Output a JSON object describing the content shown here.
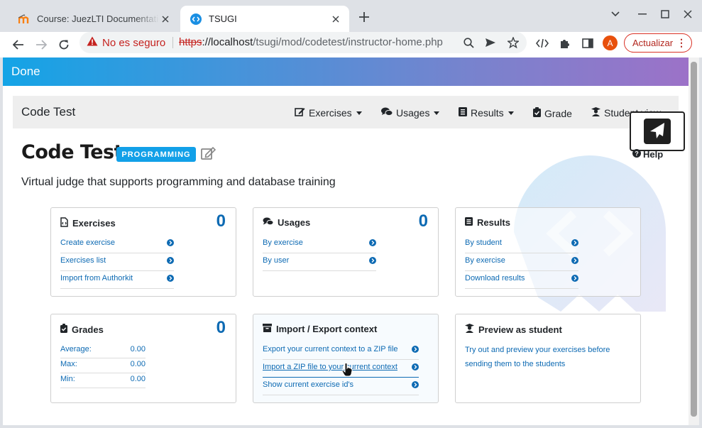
{
  "browser": {
    "tabs": [
      {
        "title": "Course: JuezLTI Documentation",
        "active": false
      },
      {
        "title": "TSUGI",
        "active": true
      }
    ],
    "security_label": "No es seguro",
    "url_scheme": "https",
    "url_host": "://localhost",
    "url_path": "/tsugi/mod/codetest/instructor-home.php",
    "avatar_letter": "A",
    "update_label": "Actualizar"
  },
  "page": {
    "done_label": "Done",
    "menubar": {
      "brand": "Code Test",
      "items": [
        {
          "label": "Exercises",
          "icon": "edit-icon",
          "dropdown": true
        },
        {
          "label": "Usages",
          "icon": "comments-icon",
          "dropdown": true
        },
        {
          "label": "Results",
          "icon": "list-icon",
          "dropdown": true
        },
        {
          "label": "Grade",
          "icon": "clipboard-check-icon",
          "dropdown": false
        },
        {
          "label": "Student view",
          "icon": "student-icon",
          "dropdown": false
        }
      ]
    },
    "help_label": "Help",
    "title": "Code Test",
    "badge": "PROGRAMMING",
    "subtitle": "Virtual judge that supports programming and database training",
    "cards": {
      "exercises": {
        "title": "Exercises",
        "count": "0",
        "links": [
          "Create exercise",
          "Exercises list",
          "Import from Authorkit"
        ]
      },
      "usages": {
        "title": "Usages",
        "count": "0",
        "links": [
          "By exercise",
          "By user"
        ]
      },
      "results": {
        "title": "Results",
        "links": [
          "By student",
          "By exercise",
          "Download results"
        ]
      },
      "grades": {
        "title": "Grades",
        "count": "0",
        "stats": [
          {
            "label": "Average:",
            "value": "0.00"
          },
          {
            "label": "Max:",
            "value": "0.00"
          },
          {
            "label": "Min:",
            "value": "0.00"
          }
        ]
      },
      "import_export": {
        "title": "Import / Export context",
        "links": [
          "Export your current context to a ZIP file",
          "Import a ZIP file to your current context",
          "Show current exercise id's"
        ]
      },
      "preview": {
        "title": "Preview as student",
        "text": "Try out and preview your exercises before sending them to the students"
      }
    }
  },
  "colors": {
    "accent": "#12a0e8",
    "link": "#0d6ab3",
    "gradient_start": "#14a4e6",
    "gradient_end": "#9c72c8"
  }
}
